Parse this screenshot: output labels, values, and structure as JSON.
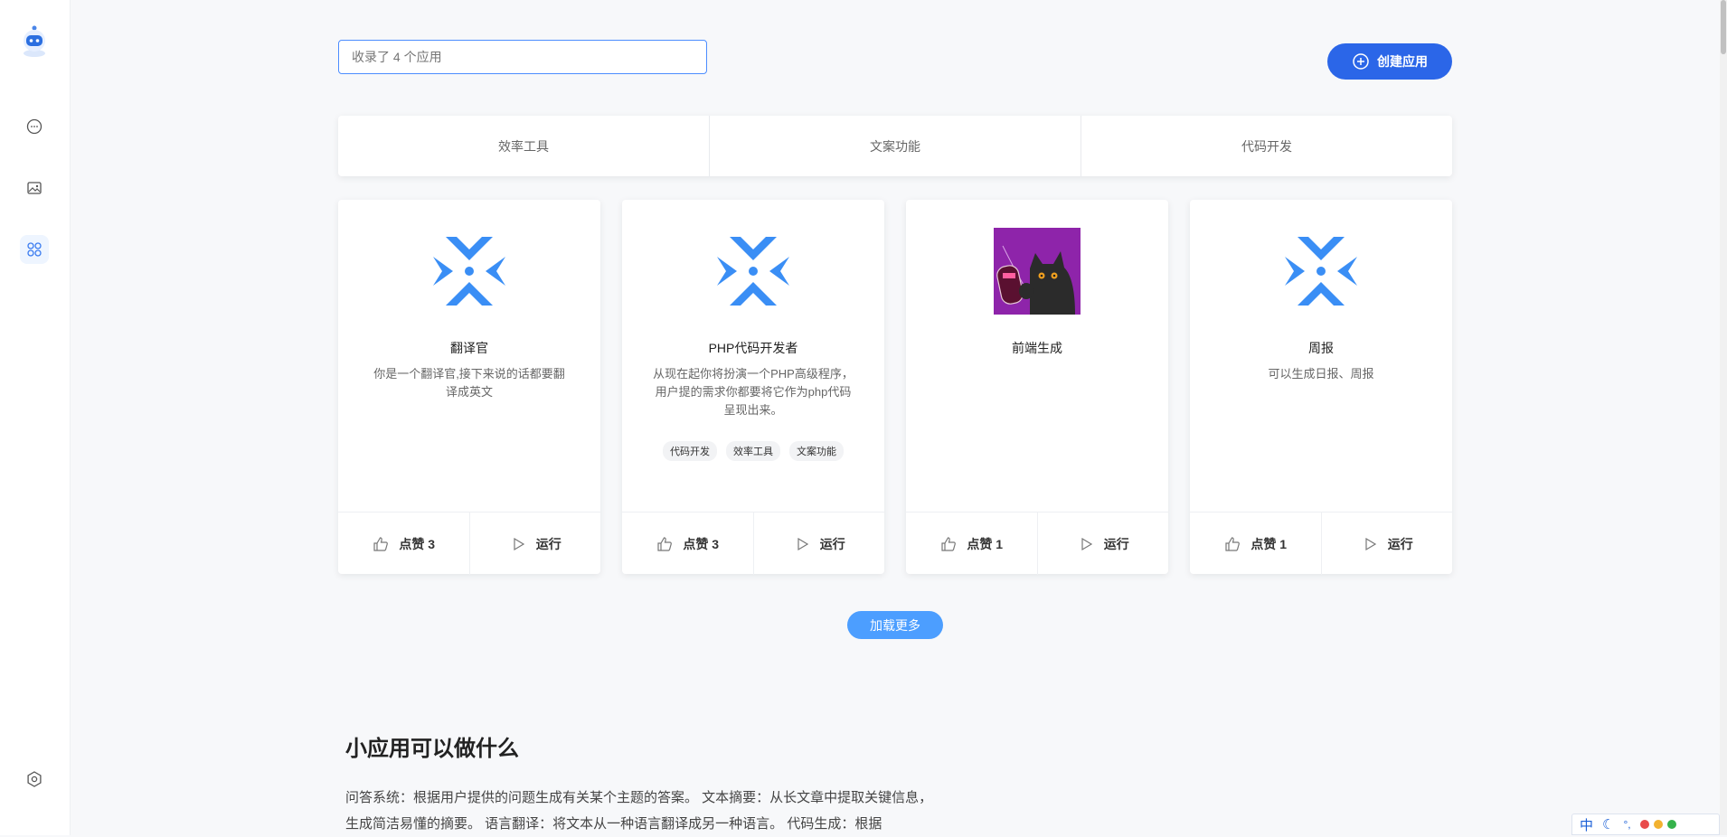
{
  "search": {
    "placeholder": "收录了 4 个应用"
  },
  "header": {
    "create_label": "创建应用"
  },
  "categories": [
    "效率工具",
    "文案功能",
    "代码开发"
  ],
  "cards": [
    {
      "name": "翻译官",
      "description": "你是一个翻译官,接下来说的话都要翻译成英文",
      "tags": [],
      "likes_label": "点赞 3",
      "run_label": "运行",
      "icon": "x-star-logo-icon"
    },
    {
      "name": "PHP代码开发者",
      "description": "从现在起你将扮演一个PHP高级程序，用户提的需求你都要将它作为php代码呈现出来。",
      "tags": [
        "代码开发",
        "效率工具",
        "文案功能"
      ],
      "likes_label": "点赞 3",
      "run_label": "运行",
      "icon": "x-star-logo-icon"
    },
    {
      "name": "前端生成",
      "description": "",
      "tags": [],
      "likes_label": "点赞 1",
      "run_label": "运行",
      "icon": "black-cat-image"
    },
    {
      "name": "周报",
      "description": "可以生成日报、周报",
      "tags": [],
      "likes_label": "点赞 1",
      "run_label": "运行",
      "icon": "x-star-logo-icon"
    }
  ],
  "load_more_label": "加载更多",
  "section": {
    "title": "小应用可以做什么",
    "text": "问答系统：根据用户提供的问题生成有关某个主题的答案。 文本摘要：从长文章中提取关键信息，生成简洁易懂的摘要。 语言翻译：将文本从一种语言翻译成另一种语言。 代码生成：根据"
  },
  "ime": {
    "lang": "中",
    "punct": "°,",
    "dot_colors": [
      "#e84b4b",
      "#f2b230",
      "#35b24b"
    ]
  },
  "colors": {
    "accent": "#2b66e8",
    "accent_light": "#4c9eff",
    "logo_blue": "#3a8ef5"
  }
}
